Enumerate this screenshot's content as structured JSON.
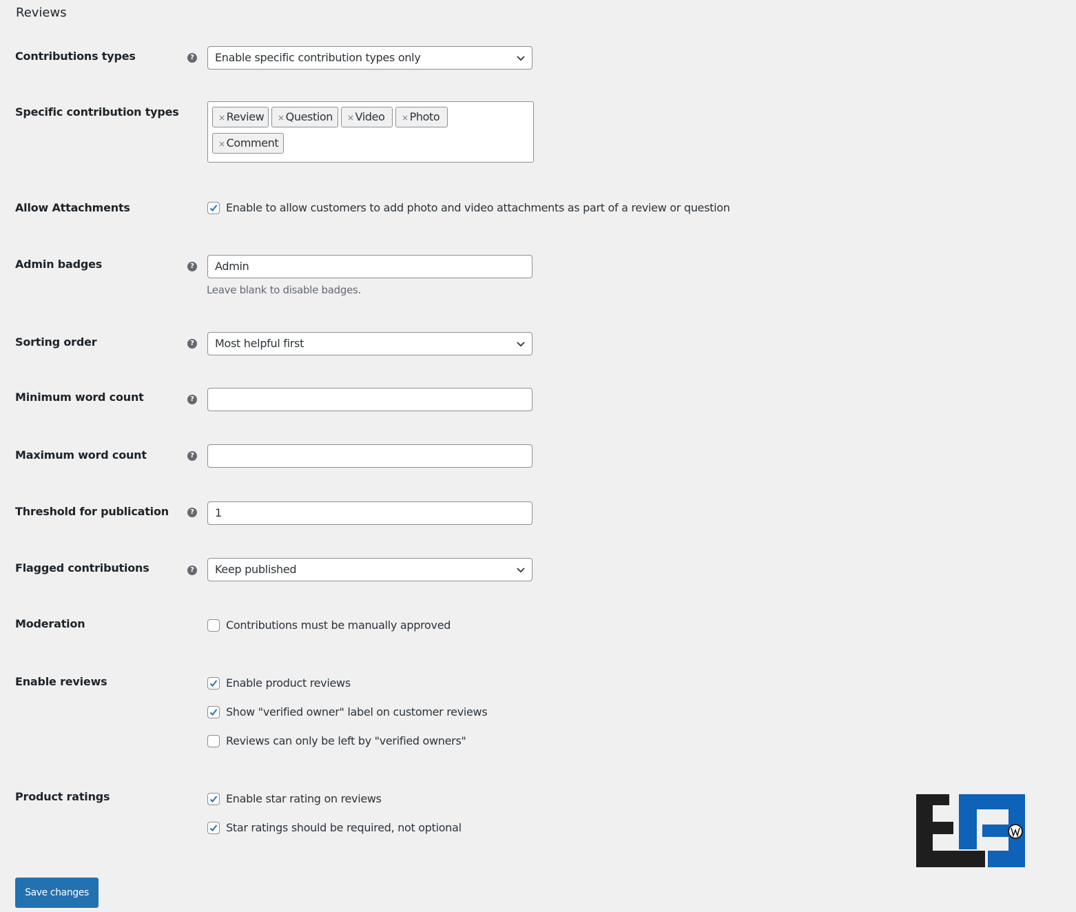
{
  "page": {
    "title": "Reviews"
  },
  "fields": {
    "contribution_types": {
      "label": "Contributions types",
      "value": "Enable specific contribution types only"
    },
    "specific_contribution_types": {
      "label": "Specific contribution types",
      "tags": [
        "Review",
        "Question",
        "Video",
        "Photo",
        "Comment"
      ],
      "remove_glyph": "×"
    },
    "allow_attachments": {
      "label": "Allow Attachments",
      "checkbox_label": "Enable to allow customers to add photo and video attachments as part of a review or question",
      "checked": true
    },
    "admin_badges": {
      "label": "Admin badges",
      "value": "Admin",
      "description": "Leave blank to disable badges."
    },
    "sorting_order": {
      "label": "Sorting order",
      "value": "Most helpful first"
    },
    "minimum_word_count": {
      "label": "Minimum word count",
      "value": ""
    },
    "maximum_word_count": {
      "label": "Maximum word count",
      "value": ""
    },
    "threshold_for_publication": {
      "label": "Threshold for publication",
      "value": "1"
    },
    "flagged_contributions": {
      "label": "Flagged contributions",
      "value": "Keep published"
    },
    "moderation": {
      "label": "Moderation",
      "checkbox_label": "Contributions must be manually approved",
      "checked": false
    },
    "enable_reviews": {
      "label": "Enable reviews",
      "options": [
        {
          "label": "Enable product reviews",
          "checked": true
        },
        {
          "label": "Show \"verified owner\" label on customer reviews",
          "checked": true
        },
        {
          "label": "Reviews can only be left by \"verified owners\"",
          "checked": false
        }
      ]
    },
    "product_ratings": {
      "label": "Product ratings",
      "options": [
        {
          "label": "Enable star rating on reviews",
          "checked": true
        },
        {
          "label": "Star ratings should be required, not optional",
          "checked": true
        }
      ]
    }
  },
  "help_glyph": "?",
  "save_button": {
    "label": "Save changes"
  },
  "colors": {
    "accent": "#2271b1",
    "background": "#f0f0f1",
    "logo_dark": "#1e1e1e",
    "logo_blue": "#0e62b8"
  },
  "icons": {
    "help": "help-icon",
    "dropdown": "chevron-down-icon",
    "check": "checkmark-icon",
    "logo": "eg-wordpress-logo"
  }
}
